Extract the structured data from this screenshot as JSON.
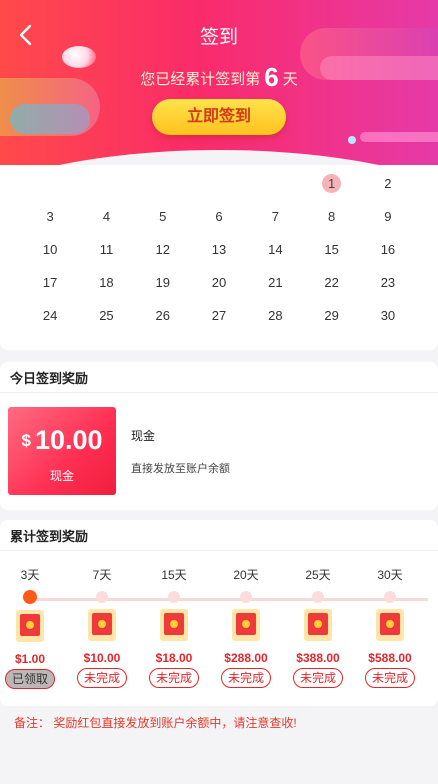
{
  "header": {
    "title": "签到",
    "summary_prefix": "您已经累计签到第",
    "summary_days": "6",
    "summary_suffix": "天",
    "signin_button": "立即签到"
  },
  "calendar": {
    "leading_blanks": 5,
    "days": [
      "1",
      "2",
      "3",
      "4",
      "5",
      "6",
      "7",
      "8",
      "9",
      "10",
      "11",
      "12",
      "13",
      "14",
      "15",
      "16",
      "17",
      "18",
      "19",
      "20",
      "21",
      "22",
      "23",
      "24",
      "25",
      "26",
      "27",
      "28",
      "29",
      "30"
    ],
    "signed_days": [
      "1"
    ],
    "signed_color": "#f7b2b8"
  },
  "today_reward": {
    "title": "今日签到奖励",
    "currency": "$",
    "amount": "10.00",
    "tile_label": "现金",
    "name": "现金",
    "description": "直接发放至账户余额"
  },
  "cumulative": {
    "title": "累计签到奖励",
    "milestones": [
      {
        "day": "3天",
        "amount": "$1.00",
        "status": "已领取",
        "done": true
      },
      {
        "day": "7天",
        "amount": "$10.00",
        "status": "未完成",
        "done": false
      },
      {
        "day": "15天",
        "amount": "$18.00",
        "status": "未完成",
        "done": false
      },
      {
        "day": "20天",
        "amount": "$288.00",
        "status": "未完成",
        "done": false
      },
      {
        "day": "25天",
        "amount": "$388.00",
        "status": "未完成",
        "done": false
      },
      {
        "day": "30天",
        "amount": "$588.00",
        "status": "未完成",
        "done": false
      }
    ]
  },
  "note": "备注： 奖励红包直接发放到账户余额中，请注意查收!",
  "colors": {
    "accent": "#fa2b6a",
    "reward_red": "#e2262c",
    "button_yellow": "#ffc21e",
    "active_dot": "#ff5a1a"
  }
}
